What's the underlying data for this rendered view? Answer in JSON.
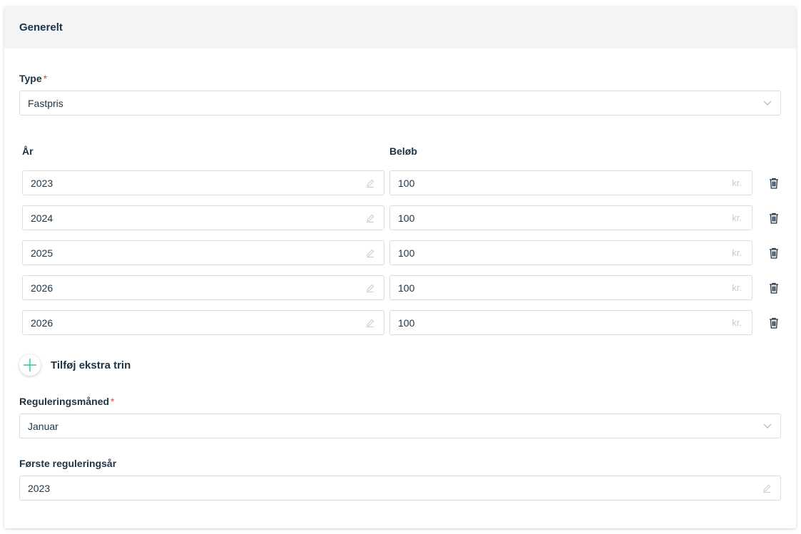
{
  "section": {
    "title": "Generelt"
  },
  "type_field": {
    "label": "Type",
    "required_mark": "*",
    "value": "Fastpris"
  },
  "columns": {
    "year_label": "År",
    "amount_label": "Beløb"
  },
  "rows": [
    {
      "year": "2023",
      "amount": "100",
      "unit": "kr."
    },
    {
      "year": "2024",
      "amount": "100",
      "unit": "kr."
    },
    {
      "year": "2025",
      "amount": "100",
      "unit": "kr."
    },
    {
      "year": "2026",
      "amount": "100",
      "unit": "kr."
    },
    {
      "year": "2026",
      "amount": "100",
      "unit": "kr."
    }
  ],
  "add_step": {
    "label": "Tilføj ekstra trin",
    "icon": "plus-icon"
  },
  "regulation_month": {
    "label": "Reguleringsmåned",
    "required_mark": "*",
    "value": "Januar"
  },
  "first_regulation_year": {
    "label": "Første reguleringsår",
    "value": "2023"
  },
  "colors": {
    "accent": "#2ec4a0",
    "label": "#1d3346",
    "required": "#e5484d",
    "border": "#d8dde2"
  }
}
